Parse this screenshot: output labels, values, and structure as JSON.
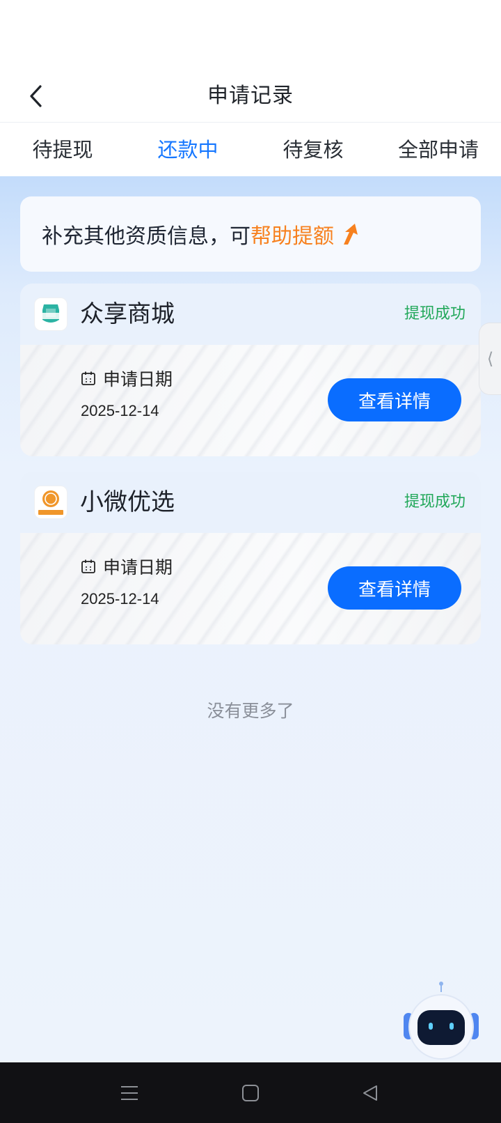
{
  "header": {
    "title": "申请记录",
    "back_icon": "chevron-left-icon"
  },
  "tabs": [
    {
      "label": "待提现",
      "active": false
    },
    {
      "label": "还款中",
      "active": true
    },
    {
      "label": "待复核",
      "active": false
    },
    {
      "label": "全部申请",
      "active": false
    }
  ],
  "promo": {
    "text": "补充其他资质信息，可",
    "highlight": "帮助提额",
    "icon": "arrow-up-icon"
  },
  "records": [
    {
      "name": "众享商城",
      "logo_text": "众享商城",
      "status": "提现成功",
      "date_label": "申请日期",
      "date": "2025-12-14",
      "button": "查看详情"
    },
    {
      "name": "小微优选",
      "logo_text": "小微优选",
      "status": "提现成功",
      "date_label": "申请日期",
      "date": "2025-12-14",
      "button": "查看详情"
    }
  ],
  "footer": {
    "no_more": "没有更多了"
  },
  "side_handle": "⟨",
  "colors": {
    "accent": "#1677ff",
    "button": "#0a6dff",
    "success": "#22a85a",
    "highlight": "#f7811f"
  },
  "nav_bar": {
    "icons": [
      "menu-icon",
      "home-square-icon",
      "back-triangle-icon"
    ]
  }
}
